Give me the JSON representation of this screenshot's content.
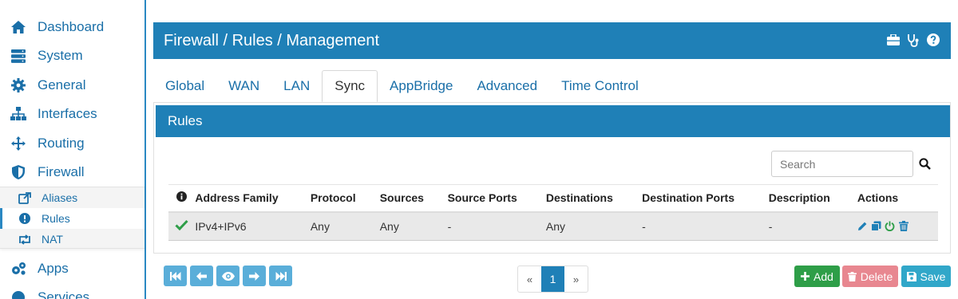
{
  "sidebar": {
    "items": [
      {
        "label": "Dashboard",
        "icon": "home-icon"
      },
      {
        "label": "System",
        "icon": "server-icon"
      },
      {
        "label": "General",
        "icon": "gear-icon"
      },
      {
        "label": "Interfaces",
        "icon": "sitemap-icon"
      },
      {
        "label": "Routing",
        "icon": "move-arrows-icon"
      },
      {
        "label": "Firewall",
        "icon": "shield-icon"
      }
    ],
    "subitems": [
      {
        "label": "Aliases",
        "icon": "share-icon"
      },
      {
        "label": "Rules",
        "icon": "exclamation-circle-icon"
      },
      {
        "label": "NAT",
        "icon": "retweet-icon"
      }
    ],
    "more": [
      {
        "label": "Apps",
        "icon": "gears-icon"
      },
      {
        "label": "Services",
        "icon": "services-icon"
      }
    ]
  },
  "header": {
    "title": "Firewall / Rules / Management"
  },
  "tabs": [
    "Global",
    "WAN",
    "LAN",
    "Sync",
    "AppBridge",
    "Advanced",
    "Time Control"
  ],
  "panel": {
    "title": "Rules"
  },
  "search": {
    "placeholder": "Search"
  },
  "table": {
    "columns": [
      "Address Family",
      "Protocol",
      "Sources",
      "Source Ports",
      "Destinations",
      "Destination Ports",
      "Description",
      "Actions"
    ],
    "rows": [
      {
        "status": "enabled",
        "address_family": "IPv4+IPv6",
        "protocol": "Any",
        "sources": "Any",
        "source_ports": "-",
        "destinations": "Any",
        "destination_ports": "-",
        "description": "-"
      }
    ]
  },
  "pagination": {
    "prev": "«",
    "current": "1",
    "next": "»"
  },
  "buttons": {
    "add": "Add",
    "delete": "Delete",
    "save": "Save"
  },
  "colors": {
    "primary": "#1f80b7",
    "link": "#1a6fa8",
    "success": "#2e9e48",
    "danger": "#e88790",
    "info": "#31a7c9",
    "nav_button": "#5aaed9"
  }
}
